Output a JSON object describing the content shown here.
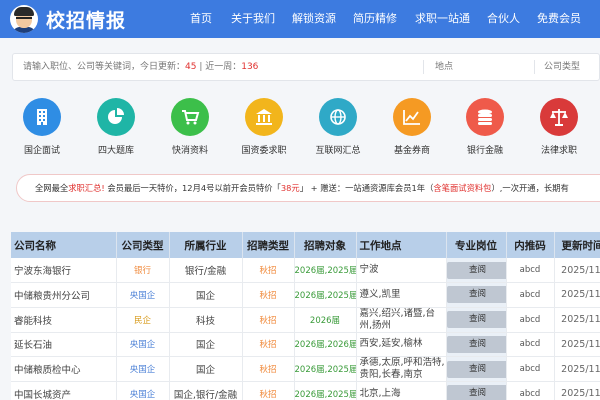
{
  "header": {
    "logo_text": "校招情报",
    "nav": [
      "首页",
      "关于我们",
      "解锁资源",
      "简历精修",
      "求职一站通",
      "合伙人",
      "免费会员"
    ]
  },
  "search": {
    "placeholder_prefix": "请输入职位、公司等关键词，今日更新：",
    "today_count": "45",
    "sep": " | 近一周：",
    "week_count": "136",
    "location": "地点",
    "company_type": "公司类型"
  },
  "categories": [
    {
      "label": "国企面试",
      "icon": "building-icon",
      "color": "#2f8de4"
    },
    {
      "label": "四大题库",
      "icon": "pie-chart-icon",
      "color": "#1fb5a6"
    },
    {
      "label": "快消资料",
      "icon": "cart-icon",
      "color": "#3cbf4a"
    },
    {
      "label": "国资委求职",
      "icon": "bank-icon",
      "color": "#f2b51c"
    },
    {
      "label": "互联网汇总",
      "icon": "globe-icon",
      "color": "#2fa9c7"
    },
    {
      "label": "基金券商",
      "icon": "line-chart-icon",
      "color": "#f59a23"
    },
    {
      "label": "银行金融",
      "icon": "coins-icon",
      "color": "#ef5a4a"
    },
    {
      "label": "法律求职",
      "icon": "scale-icon",
      "color": "#d93a3a"
    }
  ],
  "promo": {
    "prefix": "全网最全",
    "highlight1": "求职汇总!",
    "middle": " 会员最后一天特价，12月4号以前开会员特价「",
    "price": "38元",
    "after_price": "」 + 赠送：一站通资源库会员1年（",
    "highlight2": "含笔面试资料包",
    "suffix": "）,一次开通，长期有"
  },
  "table": {
    "headers": [
      "公司名称",
      "公司类型",
      "所属行业",
      "招聘类型",
      "招聘对象",
      "工作地点",
      "专业岗位",
      "内推码",
      "更新时间"
    ],
    "view_label": "查阅",
    "rows": [
      {
        "company": "宁波东海银行",
        "type": "银行",
        "type_color": "orange",
        "industry": "银行/金融",
        "recruit": "秋招",
        "target": "2026届,2025届",
        "location": "宁波",
        "code": "abcd",
        "date": "2025/11/"
      },
      {
        "company": "中储粮贵州分公司",
        "type": "央国企",
        "type_color": "blue",
        "industry": "国企",
        "recruit": "秋招",
        "target": "2026届,2025届",
        "location": "遵义,凯里",
        "code": "abcd",
        "date": "2025/11/"
      },
      {
        "company": "睿能科技",
        "type": "民企",
        "type_color": "yellow",
        "industry": "科技",
        "recruit": "秋招",
        "target": "2026届",
        "location": "嘉兴,绍兴,诸暨,台州,扬州",
        "code": "abcd",
        "date": "2025/11/"
      },
      {
        "company": "延长石油",
        "type": "央国企",
        "type_color": "blue",
        "industry": "国企",
        "recruit": "秋招",
        "target": "2026届,2026届",
        "location": "西安,延安,榆林",
        "code": "abcd",
        "date": "2025/11/"
      },
      {
        "company": "中储粮质检中心",
        "type": "央国企",
        "type_color": "blue",
        "industry": "国企",
        "recruit": "秋招",
        "target": "2026届,2025届",
        "location": "承德,太原,呼和浩特,贵阳,长春,南京",
        "code": "abcd",
        "date": "2025/11/"
      },
      {
        "company": "中国长城资产",
        "type": "央国企",
        "type_color": "blue",
        "industry": "国企,银行/金融",
        "recruit": "秋招",
        "target": "2026届,2025届",
        "location": "北京,上海",
        "code": "abcd",
        "date": "2025/11/"
      }
    ]
  }
}
